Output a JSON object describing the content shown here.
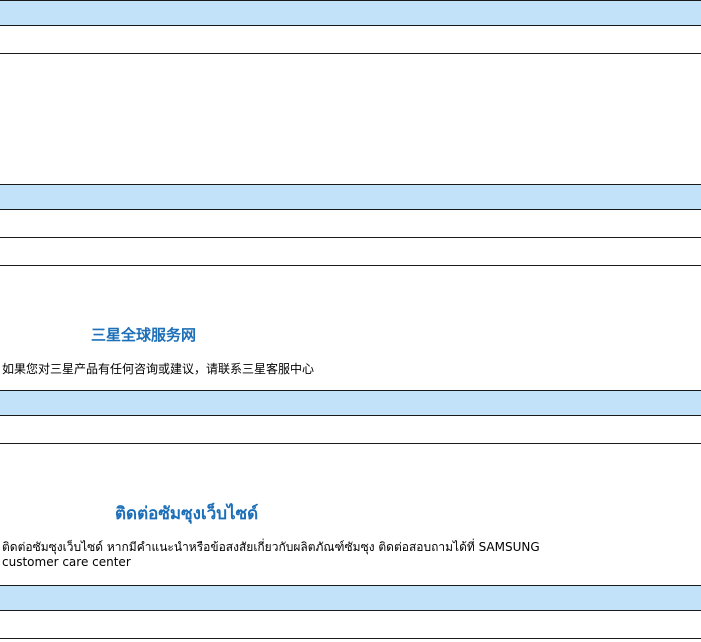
{
  "sections": [
    {
      "title": "",
      "description": "",
      "header": "",
      "rows": [
        "",
        ""
      ]
    },
    {
      "title": "",
      "description": "",
      "header": "",
      "rows": [
        "",
        "",
        ""
      ]
    },
    {
      "title": "三星全球服务网",
      "description": "如果您对三星产品有任何咨询或建议，请联系三星客服中心",
      "header": "",
      "rows": [
        "",
        ""
      ]
    },
    {
      "title": "ติดต่อซัมซุงเว็บไซด์",
      "description_line1": "ติดต่อซัมซุงเว็บไซด์ หากมีคำแนะนำหรือข้อสงสัยเกี่ยวกับผลิตภัณฑ์ซัมซุง  ติดต่อสอบถามได้ที่ SAMSUNG",
      "description_line2": "customer care center",
      "header": "",
      "rows": [
        "",
        ""
      ]
    }
  ],
  "colors": {
    "header_fill": "#c2e2fa",
    "title_color": "#1d6fb8",
    "rule": "#1a1a1a"
  }
}
